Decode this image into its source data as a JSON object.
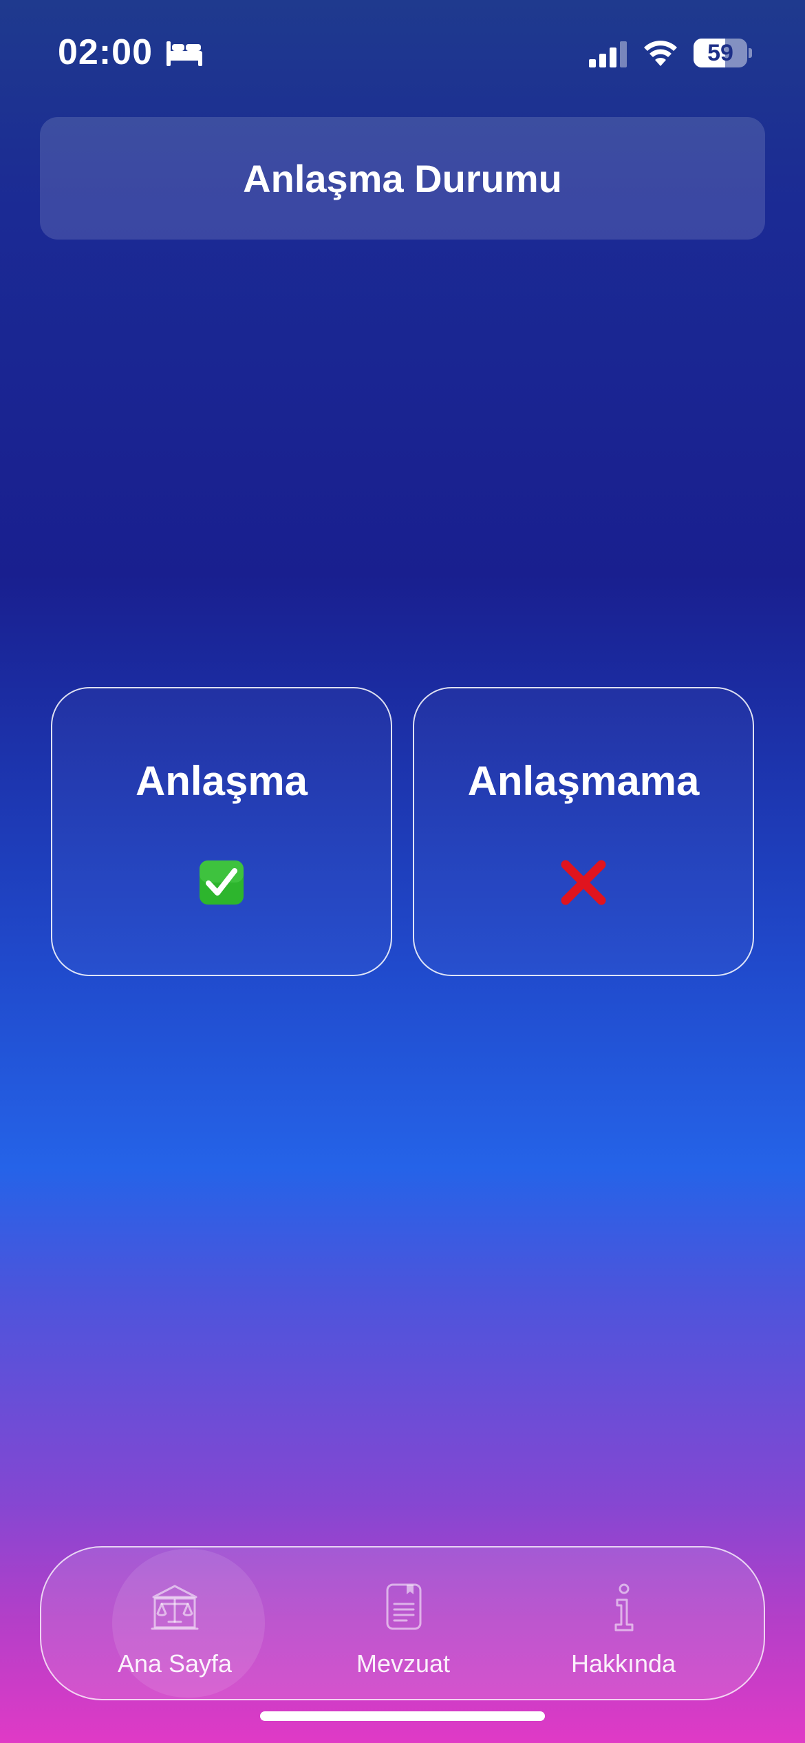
{
  "status_bar": {
    "time": "02:00",
    "battery_level": "59",
    "battery_fraction": 0.59,
    "icons": [
      "bed-icon",
      "signal-icon",
      "wifi-icon",
      "battery-icon"
    ]
  },
  "header": {
    "title": "Anlaşma Durumu"
  },
  "options": [
    {
      "label": "Anlaşma",
      "icon": "check-mark-icon",
      "color": "#2db52d"
    },
    {
      "label": "Anlaşmama",
      "icon": "cross-mark-icon",
      "color": "#e0141e"
    }
  ],
  "tab_bar": {
    "items": [
      {
        "label": "Ana Sayfa",
        "icon": "scales-building-icon",
        "active": true
      },
      {
        "label": "Mevzuat",
        "icon": "document-icon",
        "active": false
      },
      {
        "label": "Hakkında",
        "icon": "info-icon",
        "active": false
      }
    ]
  },
  "colors": {
    "gradient_top": "#1f3a8e",
    "gradient_mid": "#2563e8",
    "gradient_bottom": "#e03ac6"
  }
}
